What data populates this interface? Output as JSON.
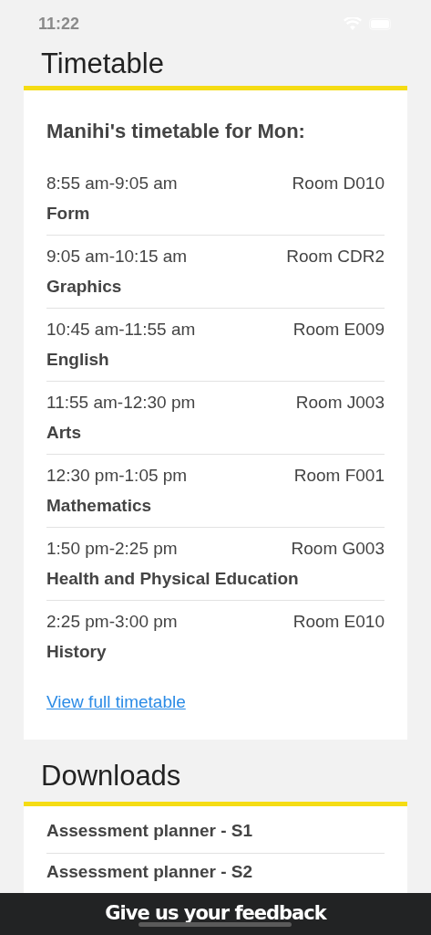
{
  "status_bar": {
    "time": "11:22"
  },
  "timetable": {
    "title": "Timetable",
    "heading": "Manihi's timetable for Mon:",
    "periods": [
      {
        "time": "8:55 am-9:05 am",
        "room": "Room D010",
        "subject": "Form"
      },
      {
        "time": "9:05 am-10:15 am",
        "room": "Room CDR2",
        "subject": "Graphics"
      },
      {
        "time": "10:45 am-11:55 am",
        "room": "Room E009",
        "subject": "English"
      },
      {
        "time": "11:55 am-12:30 pm",
        "room": "Room J003",
        "subject": "Arts"
      },
      {
        "time": "12:30 pm-1:05 pm",
        "room": "Room F001",
        "subject": "Mathematics"
      },
      {
        "time": "1:50 pm-2:25 pm",
        "room": "Room G003",
        "subject": "Health and Physical Education"
      },
      {
        "time": "2:25 pm-3:00 pm",
        "room": "Room E010",
        "subject": "History"
      }
    ],
    "link": "View full timetable"
  },
  "downloads": {
    "title": "Downloads",
    "items": [
      "Assessment planner - S1",
      "Assessment planner - S2"
    ]
  },
  "feedback_bar": {
    "label": "Give us your feedback"
  }
}
